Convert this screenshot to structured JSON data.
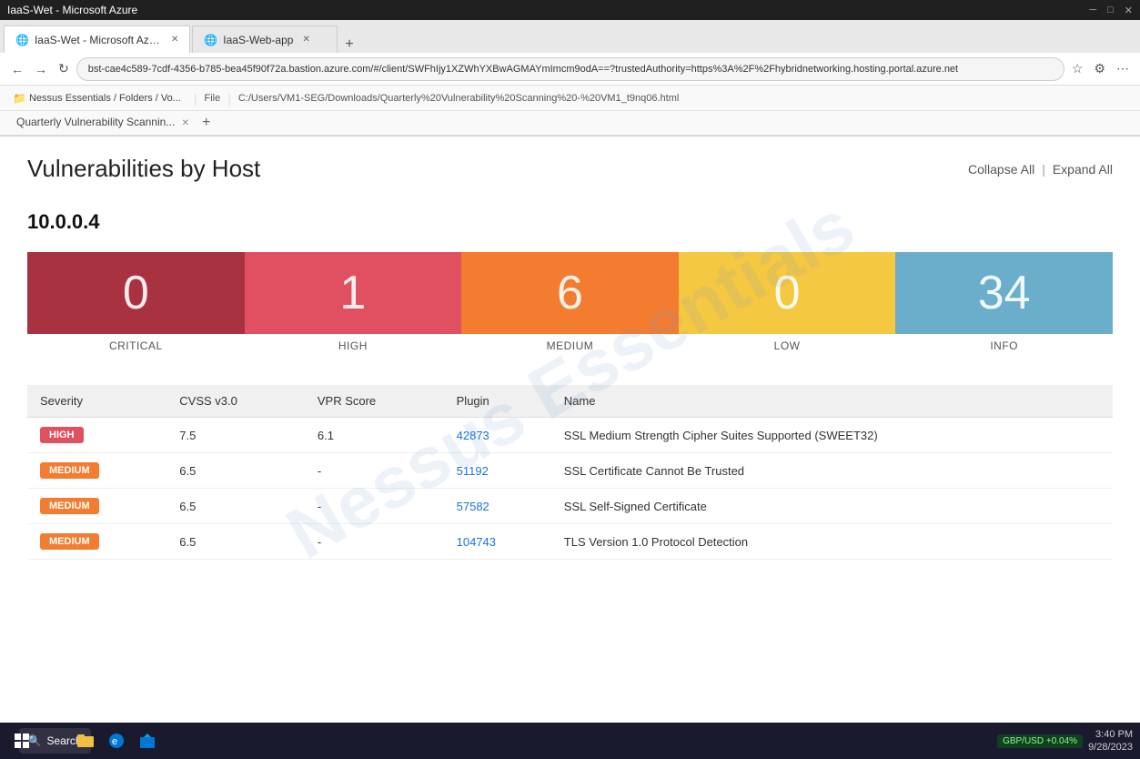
{
  "browser": {
    "title": "IaaS-Wet - Microsoft Azure",
    "tabs": [
      {
        "label": "IaaS-Wet - Microsoft Azure",
        "active": true
      },
      {
        "label": "IaaS-Web-app",
        "active": false
      }
    ],
    "address": "bst-cae4c589-7cdf-4356-b785-bea45f90f72a.bastion.azure.com/#/client/SWFhIjy1XZWhYXBwAGMAYmImcm9odA==?trustedAuthority=https%3A%2F%2Fhybridnetworking.hosting.portal.azure.net",
    "file_path": "C:/Users/VM1-SEG/Downloads/Quarterly%20Vulnerability%20Scanning%20-%20VM1_t9nq06.html",
    "bookmarks": [
      "Nessus Essentials / Folders / Vo..."
    ],
    "sec_tabs": [
      "Quarterly Vulnerability Scannin..."
    ]
  },
  "page": {
    "title": "Vulnerabilities by Host",
    "collapse_all": "Collapse All",
    "expand_all": "Expand All",
    "divider": "|"
  },
  "host": {
    "ip": "10.0.0.4"
  },
  "severity_cards": [
    {
      "key": "critical",
      "count": "0",
      "label": "CRITICAL",
      "color": "#a83240"
    },
    {
      "key": "high",
      "count": "1",
      "label": "HIGH",
      "color": "#e05060"
    },
    {
      "key": "medium",
      "count": "6",
      "label": "MEDIUM",
      "color": "#f47c30"
    },
    {
      "key": "low",
      "count": "0",
      "label": "LOW",
      "color": "#f5c842"
    },
    {
      "key": "info",
      "count": "34",
      "label": "INFO",
      "color": "#6aaecc"
    }
  ],
  "table": {
    "headers": [
      "Severity",
      "CVSS v3.0",
      "VPR Score",
      "Plugin",
      "Name"
    ],
    "rows": [
      {
        "severity": "HIGH",
        "severity_class": "badge-high",
        "cvss": "7.5",
        "vpr": "6.1",
        "plugin": "42873",
        "name": "SSL Medium Strength Cipher Suites Supported (SWEET32)"
      },
      {
        "severity": "MEDIUM",
        "severity_class": "badge-medium",
        "cvss": "6.5",
        "vpr": "-",
        "plugin": "51192",
        "name": "SSL Certificate Cannot Be Trusted"
      },
      {
        "severity": "MEDIUM",
        "severity_class": "badge-medium",
        "cvss": "6.5",
        "vpr": "-",
        "plugin": "57582",
        "name": "SSL Self-Signed Certificate"
      },
      {
        "severity": "MEDIUM",
        "severity_class": "badge-medium",
        "cvss": "6.5",
        "vpr": "-",
        "plugin": "104743",
        "name": "TLS Version 1.0 Protocol Detection"
      }
    ]
  },
  "watermark": "Nessus Essentials",
  "taskbar": {
    "search_placeholder": "Search",
    "time": "3:40 PM",
    "date": "9/28/2023",
    "stock": "GBP/USD",
    "stock_change": "+0.04%"
  }
}
